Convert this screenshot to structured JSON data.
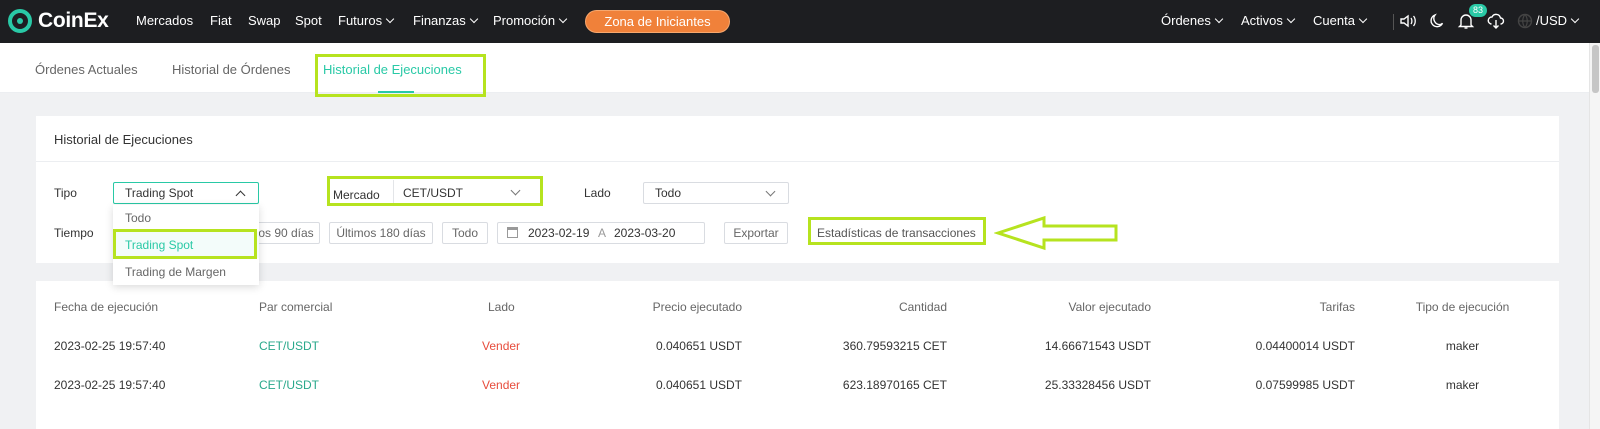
{
  "brand": {
    "name": "CoinEx",
    "accent": "#29c9a6",
    "promo_color": "#f0813a",
    "highlight_color": "#b6e31f"
  },
  "nav": {
    "items": [
      {
        "label": "Mercados",
        "dropdown": false
      },
      {
        "label": "Fiat",
        "dropdown": false
      },
      {
        "label": "Swap",
        "dropdown": false
      },
      {
        "label": "Spot",
        "dropdown": false
      },
      {
        "label": "Futuros",
        "dropdown": true
      },
      {
        "label": "Finanzas",
        "dropdown": true
      },
      {
        "label": "Promoción",
        "dropdown": true
      }
    ],
    "promo_button": "Zona de Iniciantes",
    "right_items": [
      {
        "label": "Órdenes",
        "dropdown": true
      },
      {
        "label": "Activos",
        "dropdown": true
      },
      {
        "label": "Cuenta",
        "dropdown": true
      }
    ],
    "icons": [
      "speaker-icon",
      "moon-icon",
      "bell-icon",
      "download-icon",
      "globe-icon"
    ],
    "notification_count": "83",
    "currency": "/USD"
  },
  "tabs": [
    {
      "label": "Órdenes Actuales",
      "active": false
    },
    {
      "label": "Historial de Órdenes",
      "active": false
    },
    {
      "label": "Historial de Ejecuciones",
      "active": true
    }
  ],
  "filters": {
    "title": "Historial de Ejecuciones",
    "type_label": "Tipo",
    "type_value": "Trading Spot",
    "type_options": [
      "Todo",
      "Trading Spot",
      "Trading de Margen"
    ],
    "type_selected_index": 1,
    "market_label": "Mercado",
    "market_value": "CET/USDT",
    "side_label": "Lado",
    "side_value": "Todo",
    "time_label": "Tiempo",
    "time_buttons": [
      "os 90 días",
      "Últimos 180 días",
      "Todo"
    ],
    "date_from": "2023-02-19",
    "date_to_sep": "A",
    "date_to": "2023-03-20",
    "export_label": "Exportar",
    "stats_label": "Estadísticas de transacciones"
  },
  "table": {
    "headers": [
      "Fecha de ejecución",
      "Par comercial",
      "Lado",
      "Precio ejecutado",
      "Cantidad",
      "Valor ejecutado",
      "Tarifas",
      "Tipo de ejecución"
    ],
    "rows": [
      [
        "2023-02-25 19:57:40",
        "CET/USDT",
        "Vender",
        "0.040651 USDT",
        "360.79593215 CET",
        "14.66671543 USDT",
        "0.04400014 USDT",
        "maker"
      ],
      [
        "2023-02-25 19:57:40",
        "CET/USDT",
        "Vender",
        "0.040651 USDT",
        "623.18970165 CET",
        "25.33328456 USDT",
        "0.07599985 USDT",
        "maker"
      ]
    ]
  }
}
